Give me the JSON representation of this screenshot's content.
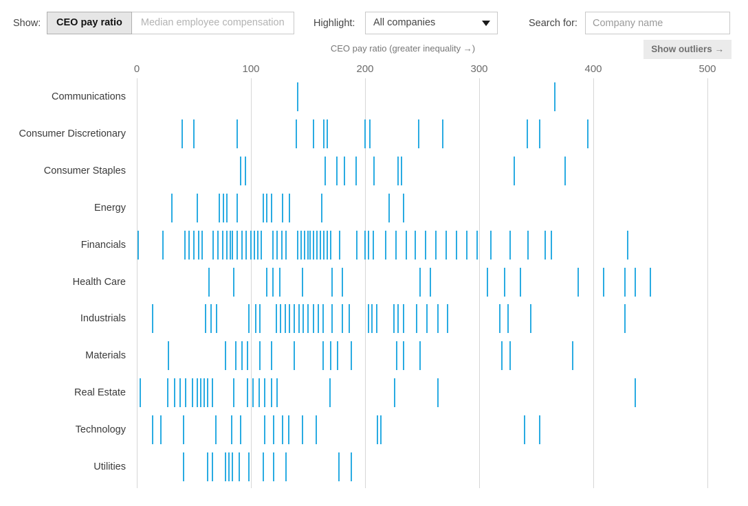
{
  "controls": {
    "show_label": "Show:",
    "toggle_options": [
      {
        "label": "CEO pay ratio",
        "active": true
      },
      {
        "label": "Median employee compensation",
        "active": false
      }
    ],
    "highlight_label": "Highlight:",
    "highlight_value": "All companies",
    "highlight_caret": "chevron-down-icon",
    "search_label": "Search for:",
    "search_placeholder": "Company name",
    "search_value": ""
  },
  "axis_title": "CEO pay ratio (greater inequality →)",
  "outliers_button": "Show outliers →",
  "chart_data": {
    "type": "scatter",
    "title": "CEO pay ratio (greater inequality →)",
    "xlabel": "CEO pay ratio",
    "ylabel": "",
    "xlim": [
      0,
      500
    ],
    "xticks": [
      0,
      100,
      200,
      300,
      400,
      500
    ],
    "grid": true,
    "legend": null,
    "orientation": "horizontal-strip",
    "mark_color": "#29ABE2",
    "categories": [
      "Communications",
      "Consumer Discretionary",
      "Consumer Staples",
      "Energy",
      "Financials",
      "Health Care",
      "Industrials",
      "Materials",
      "Real Estate",
      "Technology",
      "Utilities"
    ],
    "series": [
      {
        "name": "Communications",
        "values": [
          141,
          366
        ]
      },
      {
        "name": "Consumer Discretionary",
        "values": [
          40,
          50,
          88,
          140,
          155,
          164,
          167,
          200,
          204,
          247,
          268,
          342,
          353,
          395
        ]
      },
      {
        "name": "Consumer Staples",
        "values": [
          91,
          95,
          165,
          175,
          182,
          192,
          208,
          229,
          232,
          331,
          375
        ]
      },
      {
        "name": "Energy",
        "values": [
          31,
          53,
          72,
          76,
          79,
          88,
          111,
          114,
          118,
          128,
          134,
          162,
          221,
          234
        ]
      },
      {
        "name": "Financials",
        "values": [
          1,
          23,
          42,
          46,
          50,
          54,
          57,
          67,
          71,
          75,
          79,
          82,
          84,
          88,
          92,
          96,
          100,
          103,
          106,
          109,
          119,
          123,
          127,
          131,
          141,
          144,
          147,
          150,
          152,
          155,
          158,
          161,
          164,
          167,
          170,
          178,
          193,
          200,
          203,
          207,
          218,
          227,
          236,
          244,
          253,
          262,
          271,
          280,
          289,
          298,
          310,
          327,
          343,
          358,
          363,
          430
        ]
      },
      {
        "name": "Health Care",
        "values": [
          63,
          85,
          114,
          119,
          125,
          145,
          171,
          180,
          248,
          257,
          307,
          322,
          336,
          387,
          409,
          428,
          437,
          450
        ]
      },
      {
        "name": "Industrials",
        "values": [
          14,
          60,
          65,
          70,
          98,
          104,
          108,
          122,
          126,
          130,
          134,
          138,
          142,
          146,
          150,
          155,
          159,
          163,
          171,
          180,
          186,
          203,
          206,
          210,
          225,
          229,
          234,
          245,
          254,
          264,
          272,
          318,
          325,
          345,
          428
        ]
      },
      {
        "name": "Materials",
        "values": [
          28,
          78,
          87,
          92,
          97,
          108,
          118,
          138,
          163,
          170,
          176,
          188,
          228,
          234,
          248,
          320,
          327,
          382
        ]
      },
      {
        "name": "Real Estate",
        "values": [
          3,
          27,
          33,
          38,
          43,
          49,
          53,
          56,
          59,
          62,
          66,
          85,
          97,
          102,
          107,
          112,
          118,
          123,
          169,
          226,
          264,
          437
        ]
      },
      {
        "name": "Technology",
        "values": [
          14,
          21,
          41,
          69,
          83,
          91,
          112,
          120,
          128,
          133,
          145,
          157,
          211,
          214,
          340,
          353
        ]
      },
      {
        "name": "Utilities",
        "values": [
          41,
          62,
          66,
          78,
          81,
          84,
          90,
          98,
          111,
          120,
          131,
          177,
          188
        ]
      }
    ]
  }
}
